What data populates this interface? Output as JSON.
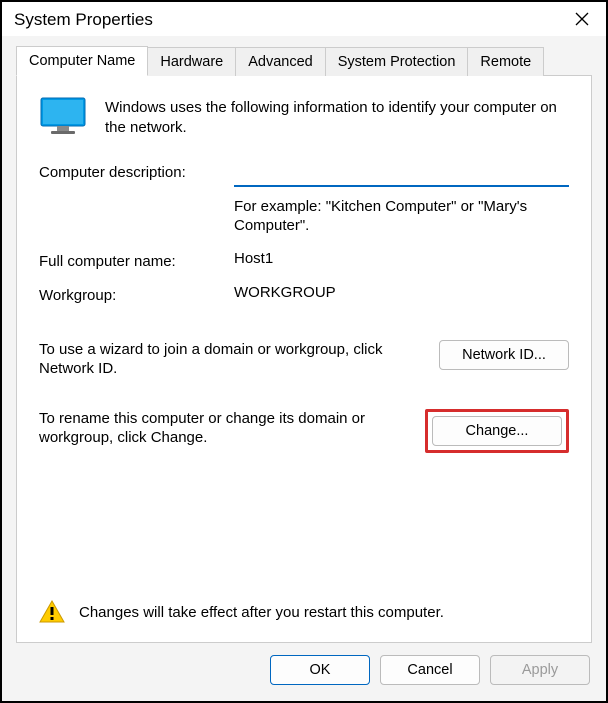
{
  "window": {
    "title": "System Properties"
  },
  "tabs": [
    {
      "label": "Computer Name",
      "active": true
    },
    {
      "label": "Hardware",
      "active": false
    },
    {
      "label": "Advanced",
      "active": false
    },
    {
      "label": "System Protection",
      "active": false
    },
    {
      "label": "Remote",
      "active": false
    }
  ],
  "panel": {
    "intro": "Windows uses the following information to identify your computer on the network.",
    "description_label": "Computer description:",
    "description_value": "",
    "example_text": "For example: \"Kitchen Computer\" or \"Mary's Computer\".",
    "full_name_label": "Full computer name:",
    "full_name_value": "Host1",
    "workgroup_label": "Workgroup:",
    "workgroup_value": "WORKGROUP",
    "network_id_text": "To use a wizard to join a domain or workgroup, click Network ID.",
    "network_id_btn": "Network ID...",
    "change_text": "To rename this computer or change its domain or workgroup, click Change.",
    "change_btn": "Change...",
    "warning": "Changes will take effect after you restart this computer."
  },
  "buttons": {
    "ok": "OK",
    "cancel": "Cancel",
    "apply": "Apply"
  }
}
